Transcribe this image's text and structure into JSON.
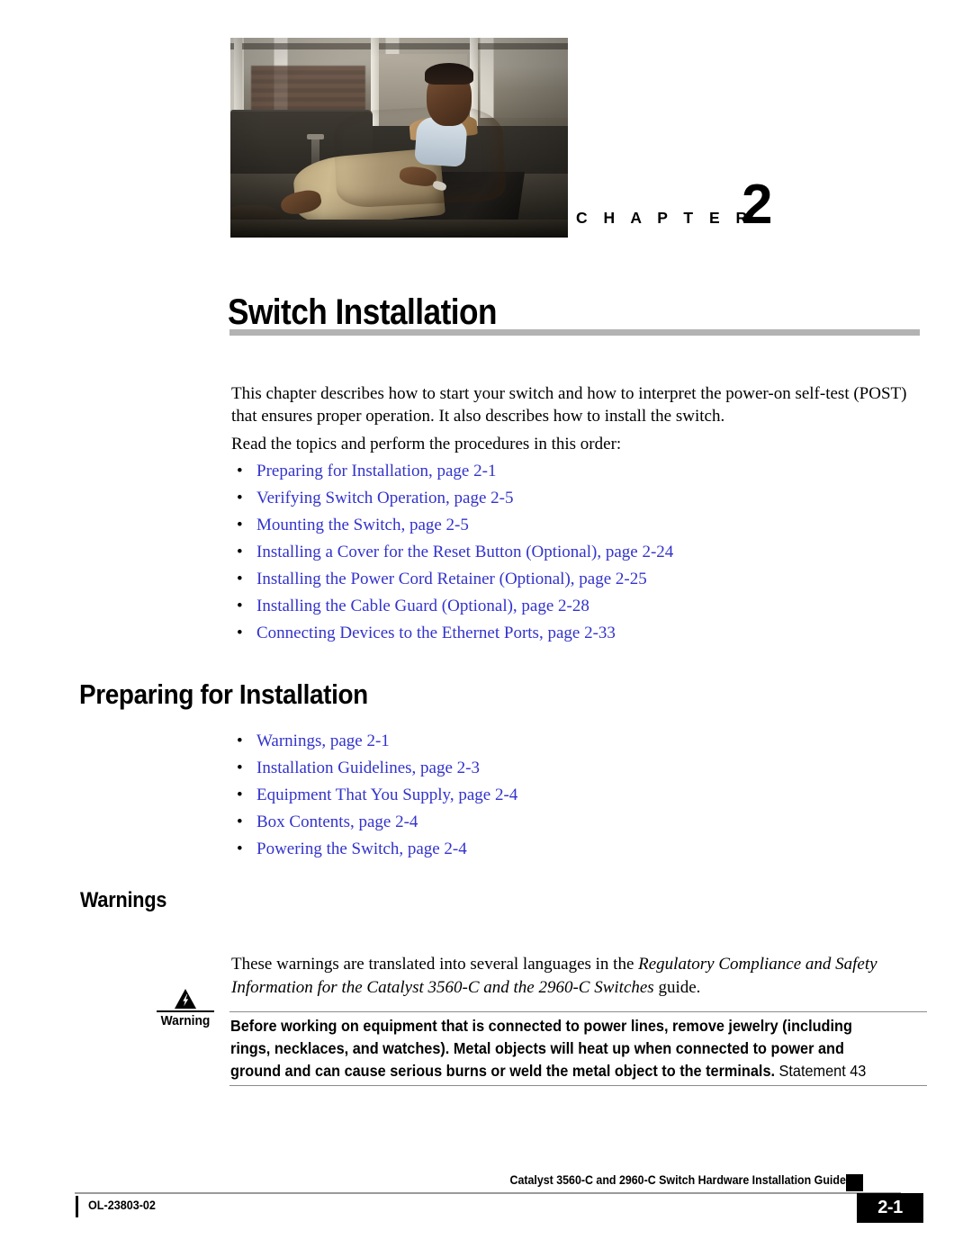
{
  "chapter": {
    "label": "C H A P T E R",
    "number": "2",
    "title": "Switch Installation",
    "photo_alt": "seated-man-tan-jacket-loft-photo"
  },
  "intro": {
    "paragraph_1": "This chapter describes how to start your switch and how to interpret the power-on self-test (POST) that ensures proper operation. It also describes how to install the switch.",
    "paragraph_2": "Read the topics and perform the procedures in this order:"
  },
  "topic_list": [
    {
      "bullet": "•",
      "text": "Preparing for Installation, page 2-1"
    },
    {
      "bullet": "•",
      "text": "Verifying Switch Operation, page 2-5"
    },
    {
      "bullet": "•",
      "text": "Mounting the Switch, page 2-5"
    },
    {
      "bullet": "•",
      "text": "Installing a Cover for the Reset Button (Optional), page 2-24"
    },
    {
      "bullet": "•",
      "text": "Installing the Power Cord Retainer (Optional), page 2-25"
    },
    {
      "bullet": "•",
      "text": "Installing the Cable Guard (Optional), page 2-28"
    },
    {
      "bullet": "•",
      "text": "Connecting Devices to the Ethernet Ports, page 2-33"
    }
  ],
  "section_preparing": {
    "heading": "Preparing for Installation",
    "list": [
      {
        "bullet": "•",
        "text": "Warnings, page 2-1"
      },
      {
        "bullet": "•",
        "text": "Installation Guidelines, page 2-3"
      },
      {
        "bullet": "•",
        "text": "Equipment That You Supply, page 2-4"
      },
      {
        "bullet": "•",
        "text": "Box Contents, page 2-4"
      },
      {
        "bullet": "•",
        "text": "Powering the Switch, page 2-4"
      }
    ]
  },
  "section_warnings": {
    "heading": "Warnings",
    "intro_before_italic": "These warnings are translated into several languages in the ",
    "intro_italic": "Regulatory Compliance and Safety Information for the Catalyst 3560-C and the 2960-C Switches",
    "intro_after_italic": " guide.",
    "warning_box": {
      "icon": "warning-lightning-triangle-icon",
      "label": "Warning",
      "body_bold": "Before working on equipment that is connected to power lines, remove jewelry (including rings, necklaces, and watches). Metal objects will heat up when connected to power and ground and can cause serious burns or weld the metal object to the terminals.",
      "statement": " Statement 43"
    }
  },
  "footer": {
    "guide_title": "Catalyst 3560-C and 2960-C Switch Hardware Installation Guide",
    "doc_id": "OL-23803-02",
    "page_number": "2-1"
  },
  "colors": {
    "link": "#3333cc",
    "rule_gray": "#b3b3b3",
    "text": "#000000",
    "footer_box": "#000000"
  }
}
